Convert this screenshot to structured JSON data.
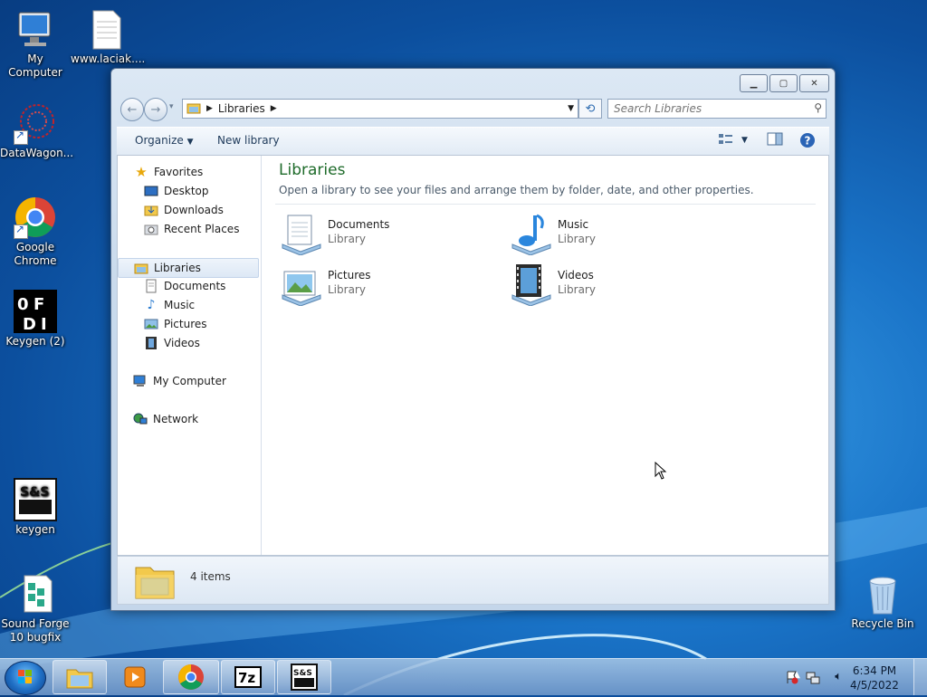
{
  "desktop": {
    "icons": [
      {
        "name": "My Computer"
      },
      {
        "name": "www.laciak...."
      },
      {
        "name": "DataWagon..."
      },
      {
        "name": "Google Chrome"
      },
      {
        "name": "Keygen (2)"
      },
      {
        "name": "keygen"
      },
      {
        "name": "Sound Forge 10 bugfix"
      },
      {
        "name": "Recycle Bin"
      }
    ]
  },
  "window": {
    "address": {
      "crumb": "Libraries"
    },
    "search": {
      "placeholder": "Search Libraries"
    },
    "toolbar": {
      "organize": "Organize",
      "new_library": "New library"
    },
    "nav": {
      "favorites": "Favorites",
      "desktop": "Desktop",
      "downloads": "Downloads",
      "recent": "Recent Places",
      "libraries": "Libraries",
      "documents": "Documents",
      "music": "Music",
      "pictures": "Pictures",
      "videos": "Videos",
      "computer": "My Computer",
      "network": "Network"
    },
    "main": {
      "title": "Libraries",
      "subtitle": "Open a library to see your files and arrange them by folder, date, and other properties.",
      "libraries": [
        {
          "name": "Documents",
          "type": "Library"
        },
        {
          "name": "Music",
          "type": "Library"
        },
        {
          "name": "Pictures",
          "type": "Library"
        },
        {
          "name": "Videos",
          "type": "Library"
        }
      ]
    },
    "details": {
      "count": "4 items"
    }
  },
  "taskbar": {
    "clock": {
      "time": "6:34 PM",
      "date": "4/5/2022"
    },
    "apps": [
      "Windows Explorer",
      "Media Player",
      "Google Chrome",
      "7-Zip",
      "keygen"
    ]
  },
  "colors": {
    "title_green": "#1e6b2a",
    "desktop_blue": "#1a74c8"
  }
}
